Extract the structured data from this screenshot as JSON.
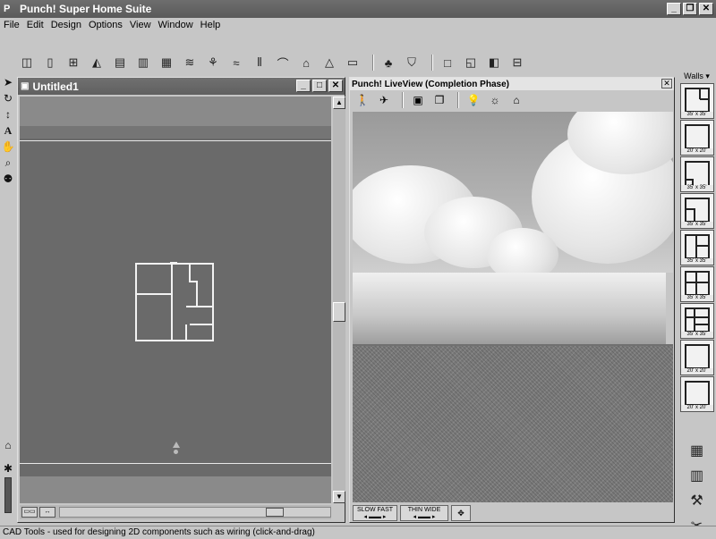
{
  "app": {
    "title": "Punch! Super Home Suite",
    "icon_label": "P"
  },
  "menu": [
    "File",
    "Edit",
    "Design",
    "Options",
    "View",
    "Window",
    "Help"
  ],
  "plan_window": {
    "title": "Untitled1"
  },
  "liveview": {
    "title": "Punch! LiveView (Completion Phase)",
    "speed_left": "SLOW",
    "speed_right": "FAST",
    "width_left": "THIN",
    "width_right": "WIDE"
  },
  "library": {
    "label": "Walls ▾",
    "tiles": [
      {
        "size": "35' x 35'"
      },
      {
        "size": "20' x 20'"
      },
      {
        "size": "35' x 35'"
      },
      {
        "size": "35' x 35'"
      },
      {
        "size": "35' x 35'"
      },
      {
        "size": "35' x 35'"
      },
      {
        "size": "35' x 35'"
      },
      {
        "size": "20' x 20'"
      },
      {
        "size": "20' x 20'"
      }
    ]
  },
  "status": "CAD Tools - used for designing 2D components such as wiring (click-and-drag)",
  "colors": {
    "titlebar": "#5f5f5f",
    "canvas": "#6a6a6a",
    "panel": "#c6c6c6"
  }
}
